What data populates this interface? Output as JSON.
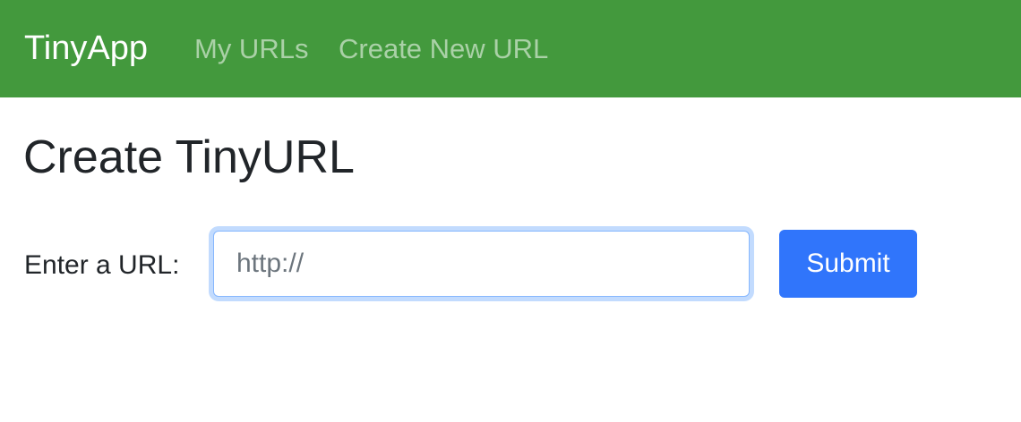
{
  "navbar": {
    "brand": "TinyApp",
    "links": [
      {
        "label": "My URLs"
      },
      {
        "label": "Create New URL"
      }
    ],
    "background_color": "#43993d"
  },
  "main": {
    "title": "Create TinyURL",
    "form": {
      "label": "Enter a URL:",
      "url_input": {
        "value": "",
        "placeholder": "http://",
        "focused": true
      },
      "submit_label": "Submit",
      "submit_color": "#3075fb"
    }
  }
}
